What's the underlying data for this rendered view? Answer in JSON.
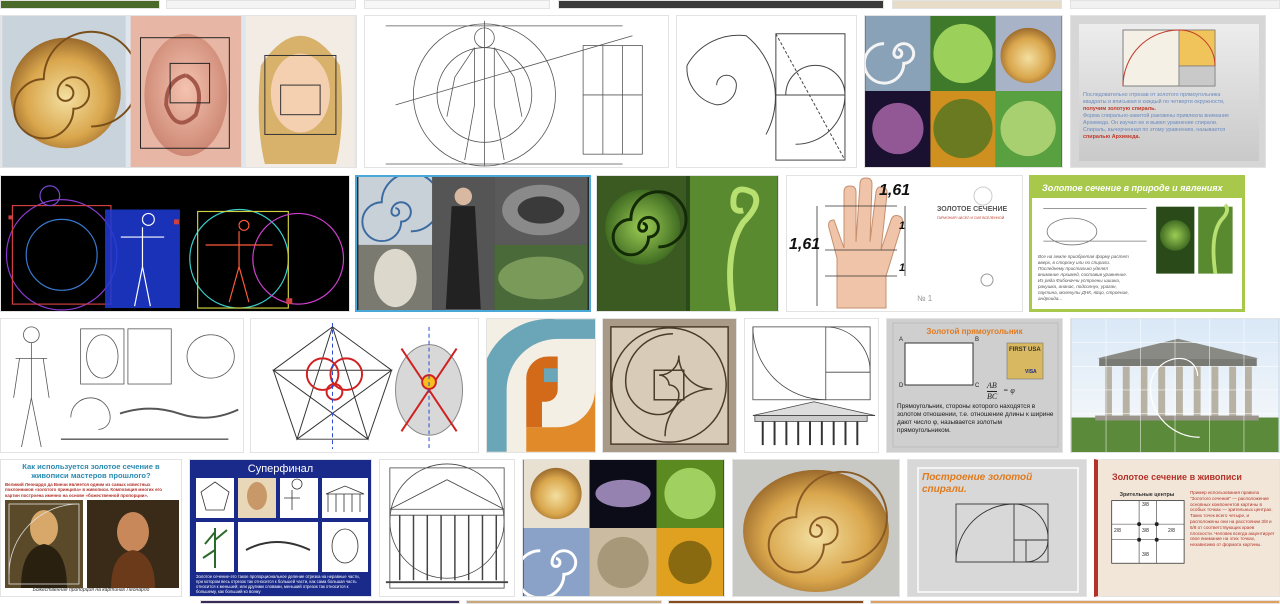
{
  "colors": {
    "page_bg": "#ffffff",
    "tile_border": "#e3e3e3",
    "golden": "#d4a24a",
    "accent_green": "#a7c84a",
    "accent_orange": "#e07a1e",
    "slide_blue": "#1a2a8a",
    "text_red": "#b3322a"
  },
  "tiles": {
    "golden_slide": {
      "lines": [
        "Последовательно отрезав от золотого прямоугольника",
        "квадраты и вписывая в каждый по четверти окружности,",
        "получим золотую спираль.",
        "Форма спирально-завитой раковины привлекла внимание",
        "Архимеда. Он изучал ее и вывел уравнение спирали.",
        "Спираль, вычерченная по этому уравнению, называется",
        "спиралью Архимеда."
      ]
    },
    "hand_golden": {
      "value_1": "1,61",
      "value_2": "1,61",
      "value_3": "1",
      "value_4": "1",
      "brand_title": "ЗОЛОТОЕ СЕЧЕНИЕ",
      "brand_sub": "ГАРМОНИЯ ЧИСЕЛ И СИЛ ВСЕЛЕННОЙ",
      "page_no": "№ 1"
    },
    "nature_slide": {
      "title": "Золотое сечение в природе и явлениях",
      "lines": [
        "Все на земле приобретая форму растет",
        "вверх, в сторону или по спирали.",
        "Последнему пристально уделял",
        "внимание Архимед, составив уравнение.",
        "Из ряда Фибоначчи устроены шишка,",
        "ракушка, ананас, подсолнух, ураган,",
        "паутина, молекулы ДНК, яйцо, строение,",
        "андроида..."
      ]
    },
    "golden_rect": {
      "title": "Золотой прямоугольник",
      "card_brand": "FIRST USA",
      "card_type": "VISA",
      "formula_top": "AB",
      "formula_bottom": "BC",
      "formula_eq": "= φ",
      "label_a": "A",
      "label_b": "B",
      "label_c": "C",
      "label_d": "D",
      "body": "Прямоугольник, стороны которого находятся в золотом отношении, т.е. отношение длины к ширине дают число φ, называется золотым прямоугольником."
    },
    "mona_lisa": {
      "title": "Как используется золотое сечение в живописи мастеров прошлого?",
      "intro": "Великий Леонардо да Винчи является одним из самых известных поклонников «золотого принципа» в живописи. Композиция многих его картин построена именно на основе «божественной пропорции».",
      "caption": "Божественная пропорция на картинах Леонардо"
    },
    "superfinal": {
      "title": "Суперфинал",
      "text": "Золотое сечение-это такое пропорциональное деление отрезка на неравные части, при котором весь отрезок так относится к большей части, как сама большая часть относится к меньшей; или другими словами, меньший отрезок так относится к большему, как больший ко всему"
    },
    "spiral_build": {
      "title": "Построение золотой спирали."
    },
    "painting_slide": {
      "title": "Золотое сечение в живописи",
      "centers_label": "Зрительные центры",
      "frac_a": "3/8",
      "frac_b": "2/8",
      "frac_c": "3/8",
      "frac_d": "2/8",
      "frac_e": "3/8",
      "text": "Пример использования правила \"Золотого сечения\" — расположение основных компонентов картины в особых точках — зрительных центрах. Таких точек всего четыре, и расположены они на расстоянии 3/8 и 5/8 от соответствующих краев плоскости. Человек всегда акцентирует свое внимание на этих точках, независимо от формата картины."
    }
  }
}
